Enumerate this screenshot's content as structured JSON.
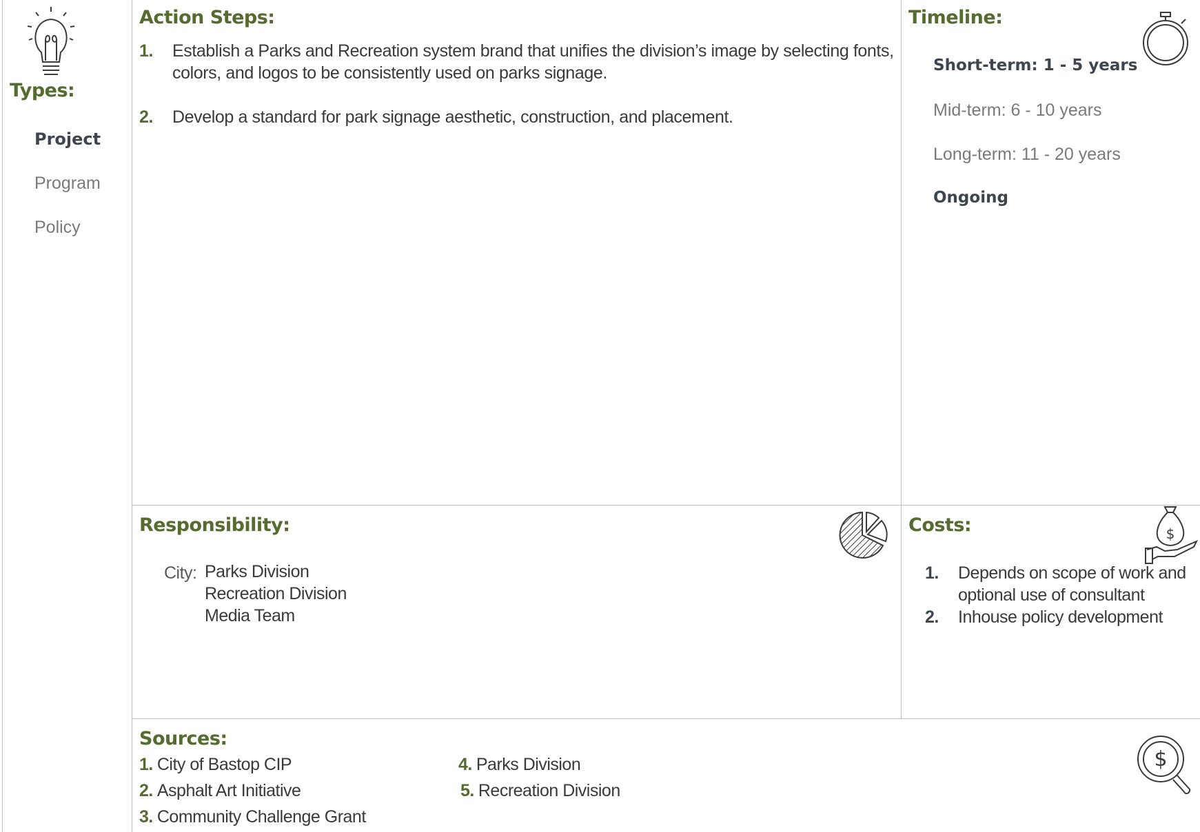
{
  "types": {
    "heading": "Types:",
    "items": [
      {
        "label": "Project",
        "active": true
      },
      {
        "label": "Program",
        "active": false
      },
      {
        "label": "Policy",
        "active": false
      }
    ]
  },
  "action_steps": {
    "heading": "Action Steps:",
    "items": [
      {
        "num": "1.",
        "text": "Establish a Parks and Recreation system brand that unifies the division’s image by selecting fonts, colors, and logos to be consistently used on parks signage."
      },
      {
        "num": "2.",
        "text": "Develop a standard for park signage aesthetic, construction, and placement."
      }
    ]
  },
  "timeline": {
    "heading": "Timeline:",
    "items": [
      {
        "label": "Short-term:  1 - 5 years",
        "active": true
      },
      {
        "label": "Mid-term:  6 - 10 years",
        "active": false
      },
      {
        "label": "Long-term:  11 - 20 years",
        "active": false
      },
      {
        "label": "Ongoing",
        "active": true
      }
    ]
  },
  "responsibility": {
    "heading": "Responsibility:",
    "label": "City:",
    "items": [
      "Parks Division",
      "Recreation Division",
      "Media Team"
    ]
  },
  "costs": {
    "heading": "Costs:",
    "items": [
      {
        "num": "1.",
        "text": "Depends on scope of work and optional use of consultant"
      },
      {
        "num": "2.",
        "text": "Inhouse policy development"
      }
    ]
  },
  "sources": {
    "heading": "Sources:",
    "items": [
      {
        "num": "1.",
        "text": "City of Bastop CIP"
      },
      {
        "num": "2.",
        "text": "Asphalt Art Initiative"
      },
      {
        "num": "3.",
        "text": "Community Challenge Grant"
      },
      {
        "num": "4.",
        "text": "Parks Division"
      },
      {
        "num": "5.",
        "text": "Recreation Division"
      }
    ]
  },
  "icons": {
    "types": "lightbulb-icon",
    "timeline": "stopwatch-icon",
    "responsibility": "pie-chart-icon",
    "costs": "money-bag-hand-icon",
    "sources": "magnifier-dollar-icon"
  },
  "colors": {
    "heading": "#556b2f",
    "active_text": "#3d4650",
    "muted_text": "#7a7a7a",
    "divider": "#bdbdbd"
  }
}
